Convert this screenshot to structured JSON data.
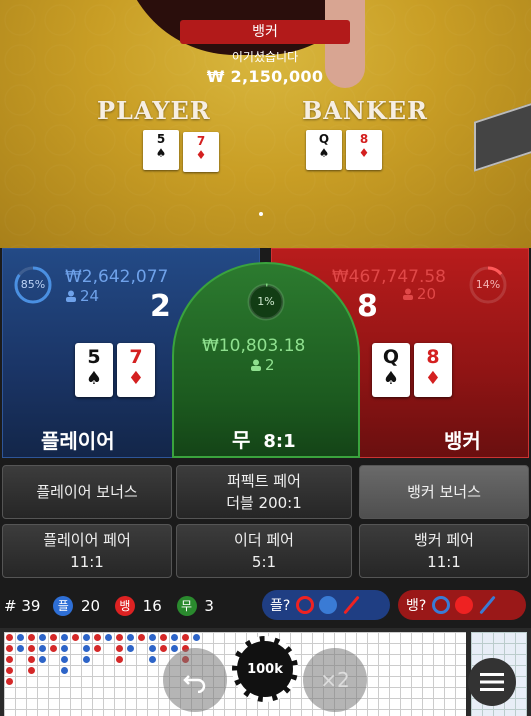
{
  "table": {
    "banner": "뱅커",
    "win_label": "이기셨습니다",
    "win_amount": "₩ 2,150,000",
    "player_word": "PLAYER",
    "banker_word": "BANKER",
    "player_cards": [
      {
        "rank": "5",
        "suit": "♠",
        "color": "black"
      },
      {
        "rank": "7",
        "suit": "♦",
        "color": "red"
      }
    ],
    "banker_cards": [
      {
        "rank": "Q",
        "suit": "♠",
        "color": "black"
      },
      {
        "rank": "8",
        "suit": "♦",
        "color": "red"
      }
    ]
  },
  "player": {
    "percent": "85%",
    "percent_value": 0.85,
    "amount": "₩2,642,077",
    "count": "24",
    "score": "2",
    "label": "플레이어",
    "cards": [
      {
        "rank": "5",
        "suit": "♠",
        "color": "black"
      },
      {
        "rank": "7",
        "suit": "♦",
        "color": "red"
      }
    ]
  },
  "tie": {
    "percent": "1%",
    "percent_value": 0.01,
    "amount": "₩10,803.18",
    "count": "2",
    "label": "무",
    "payout": "8:1"
  },
  "banker": {
    "percent": "14%",
    "percent_value": 0.14,
    "amount": "₩467,747.58",
    "count": "20",
    "score": "8",
    "label": "뱅커",
    "cards": [
      {
        "rank": "Q",
        "suit": "♠",
        "color": "black"
      },
      {
        "rank": "8",
        "suit": "♦",
        "color": "red"
      }
    ]
  },
  "side_bets": {
    "player_bonus": "플레이어 보너스",
    "perfect_pair": "퍼펙트 페어",
    "either_line2": "더블 200:1",
    "banker_bonus": "뱅커 보너스",
    "player_pair": "플레이어 페어",
    "player_pair_odds": "11:1",
    "either_pair": "이더 페어",
    "either_pair_odds": "5:1",
    "banker_pair": "뱅커 페어",
    "banker_pair_odds": "11:1"
  },
  "stats": {
    "hash": "#",
    "rounds": "39",
    "player_badge": "플",
    "player_wins": "20",
    "banker_badge": "뱅",
    "banker_wins": "16",
    "tie_badge": "무",
    "ties": "3",
    "player_predict": "플?",
    "banker_predict": "뱅?"
  },
  "controls": {
    "chip": "100k",
    "double": "×2"
  },
  "colors": {
    "player_blue": "#1a3465",
    "banker_red": "#8f1414",
    "tie_green": "#1c5a1f",
    "accent_blue": "#3a7bd5",
    "accent_red": "#e22222"
  }
}
